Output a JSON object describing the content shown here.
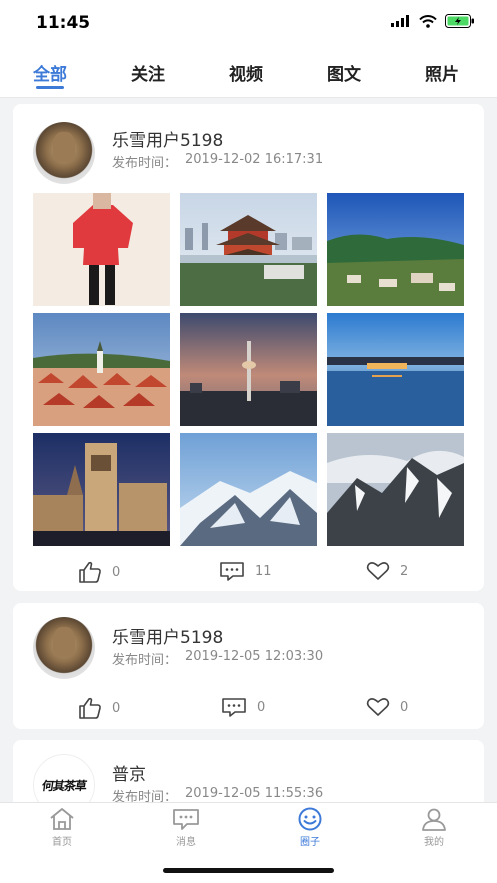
{
  "status": {
    "time": "11:45",
    "icons": [
      "cellular-signal-icon",
      "wifi-icon",
      "battery-charging-icon"
    ]
  },
  "tabs": [
    {
      "label": "全部",
      "active": true
    },
    {
      "label": "关注",
      "active": false
    },
    {
      "label": "视频",
      "active": false
    },
    {
      "label": "图文",
      "active": false
    },
    {
      "label": "照片",
      "active": false
    }
  ],
  "posts": [
    {
      "username": "乐雪用户5198",
      "time_label": "发布时间：",
      "time_value": "2019-12-02 16:17:31",
      "avatar": "cat-avatar",
      "photos": [
        "person-in-red-jacket",
        "chinese-pavilion-skyline",
        "mountain-village-landscape",
        "red-roof-old-town",
        "tv-tower-dusk",
        "lakeside-city-night",
        "cathedral-night",
        "snowy-mountains",
        "snowy-peaks-clouds"
      ],
      "likes": "0",
      "comments": "11",
      "favorites": "2"
    },
    {
      "username": "乐雪用户5198",
      "time_label": "发布时间：",
      "time_value": "2019-12-05 12:03:30",
      "avatar": "cat-avatar",
      "photos": [],
      "likes": "0",
      "comments": "0",
      "favorites": "0"
    },
    {
      "username": "普京",
      "time_label": "发布时间：",
      "time_value": "2019-12-05 11:55:36",
      "avatar": "calligraphy-avatar",
      "avatar_text": "何其茶草",
      "photos": []
    }
  ],
  "bottom_nav": [
    {
      "label": "首页",
      "icon": "home-icon",
      "active": false
    },
    {
      "label": "消息",
      "icon": "message-icon",
      "active": false
    },
    {
      "label": "圈子",
      "icon": "circle-smile-icon",
      "active": true
    },
    {
      "label": "我的",
      "icon": "user-icon",
      "active": false
    }
  ],
  "colors": {
    "accent": "#3d7ad8",
    "background": "#f2f3f5",
    "text_secondary": "#888888"
  }
}
